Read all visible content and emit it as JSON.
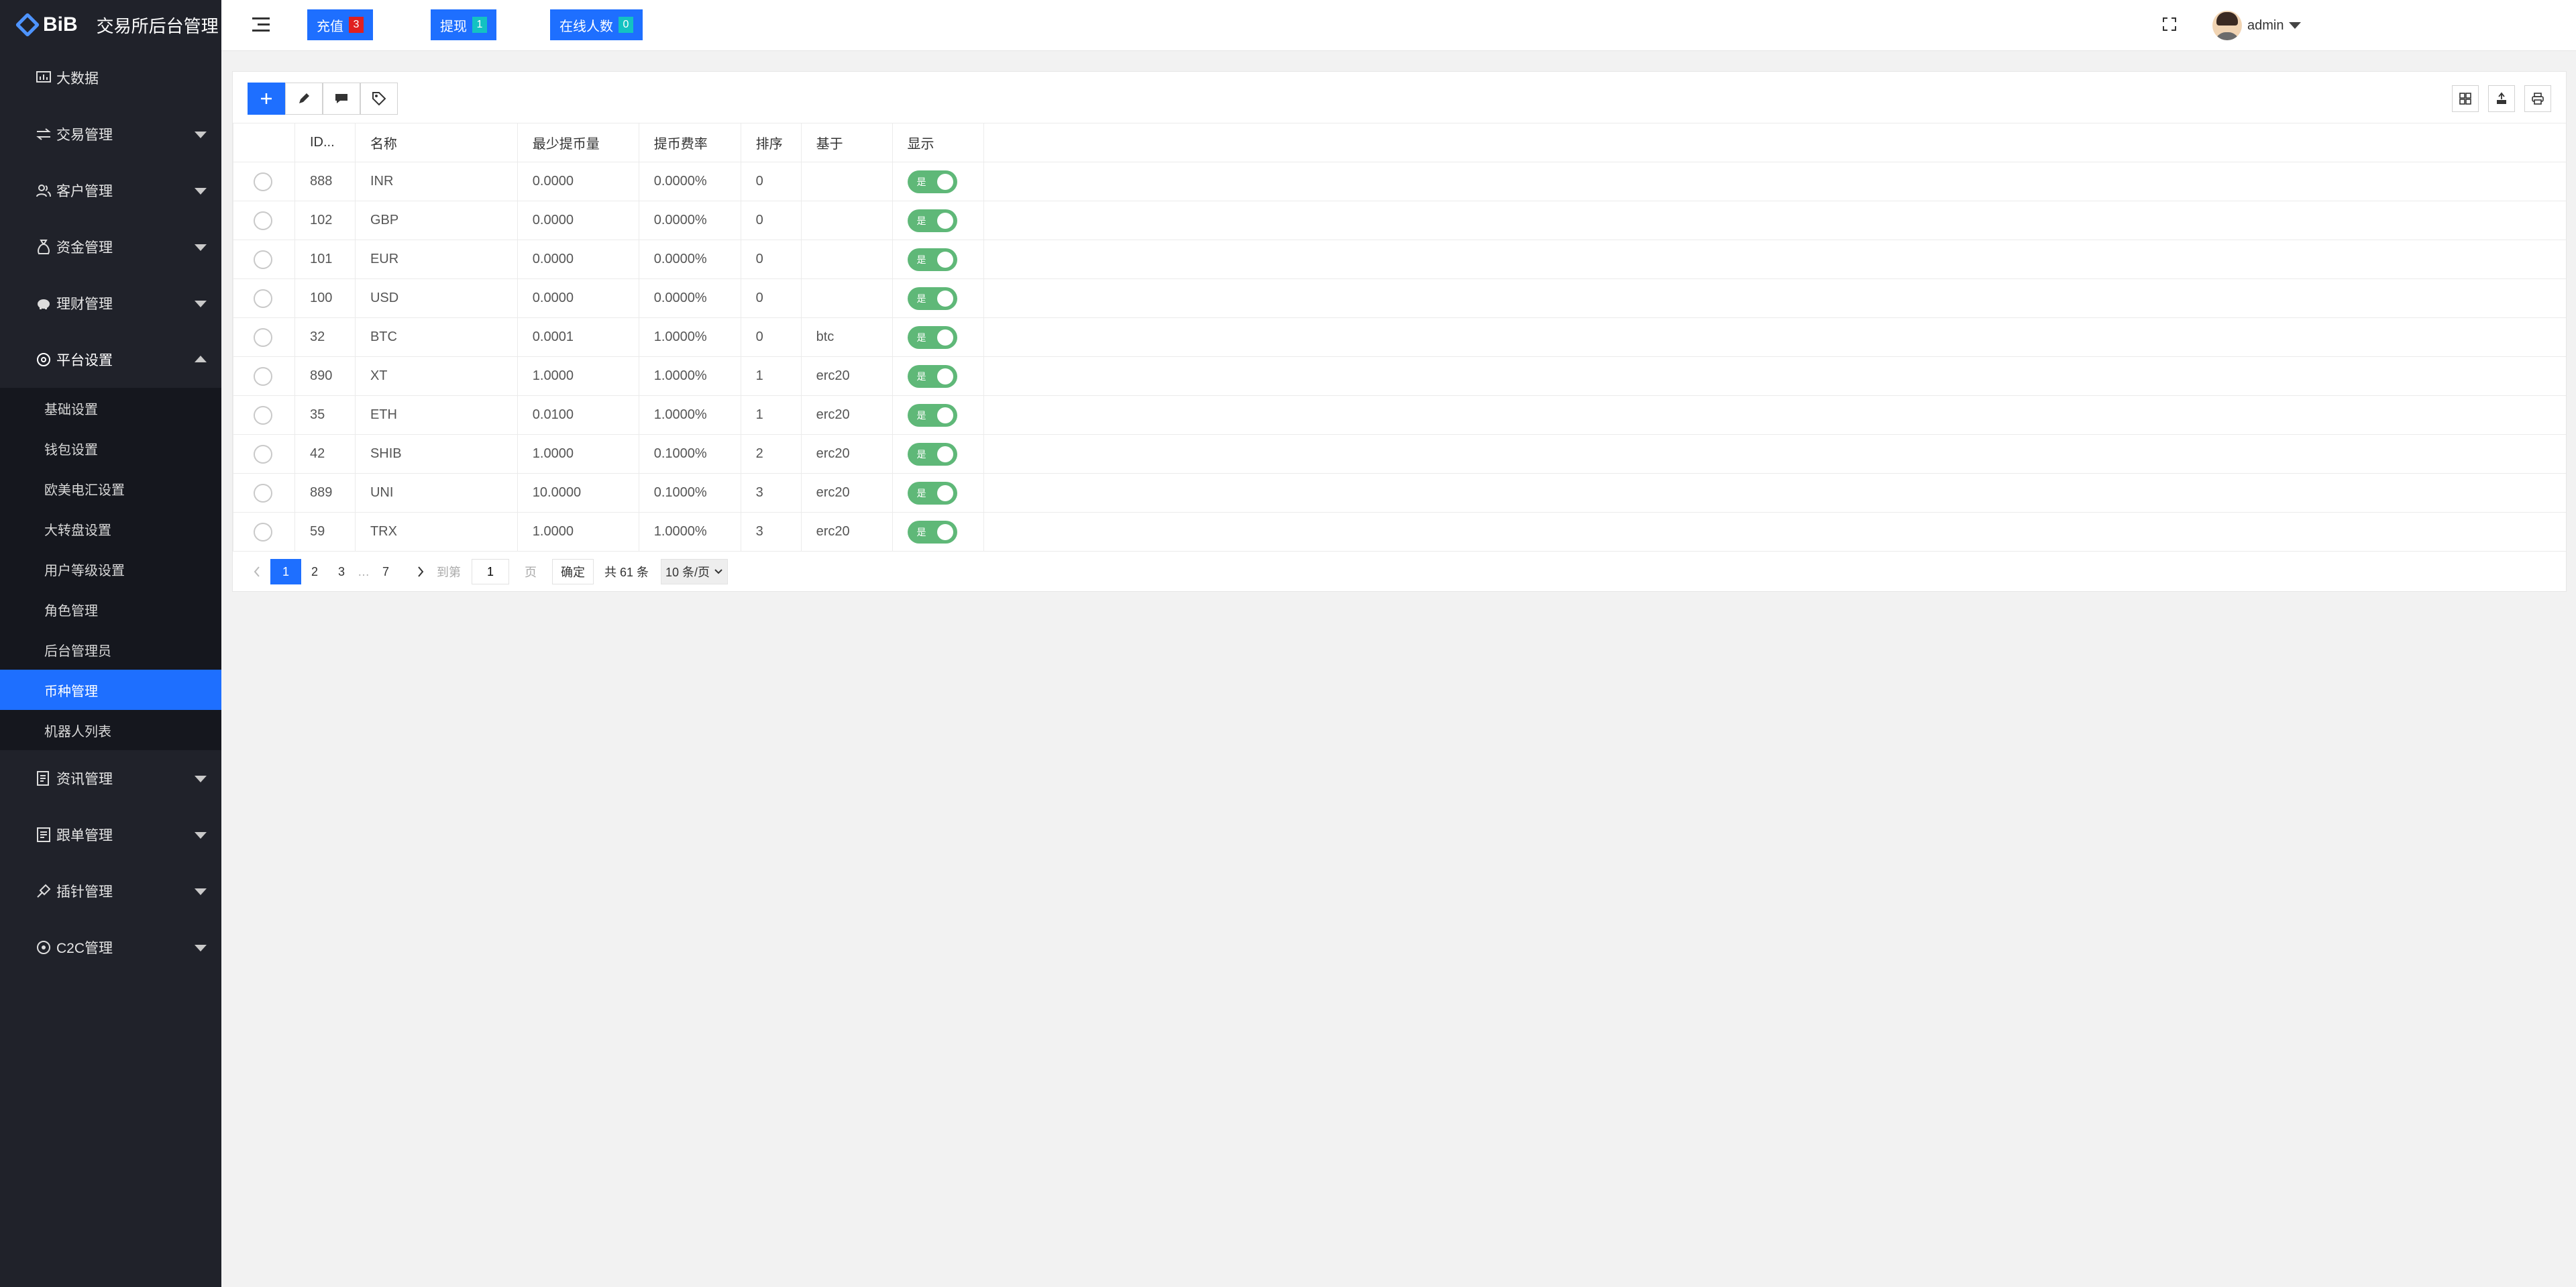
{
  "brand": {
    "logo_text": "BiB",
    "title": "交易所后台管理"
  },
  "sidebar": {
    "items": [
      {
        "label": "大数据",
        "icon": "dashboard-icon"
      },
      {
        "label": "交易管理",
        "icon": "exchange-icon"
      },
      {
        "label": "客户管理",
        "icon": "users-icon"
      },
      {
        "label": "资金管理",
        "icon": "money-bag-icon"
      },
      {
        "label": "理财管理",
        "icon": "piggy-bank-icon"
      },
      {
        "label": "平台设置",
        "icon": "settings-icon"
      },
      {
        "label": "资讯管理",
        "icon": "news-icon"
      },
      {
        "label": "跟单管理",
        "icon": "copy-trade-icon"
      },
      {
        "label": "插针管理",
        "icon": "pin-icon"
      },
      {
        "label": "C2C管理",
        "icon": "c2c-icon"
      }
    ],
    "submenu": [
      {
        "label": "基础设置"
      },
      {
        "label": "钱包设置"
      },
      {
        "label": "欧美电汇设置"
      },
      {
        "label": "大转盘设置"
      },
      {
        "label": "用户等级设置"
      },
      {
        "label": "角色管理"
      },
      {
        "label": "后台管理员"
      },
      {
        "label": "币种管理"
      },
      {
        "label": "机器人列表"
      }
    ]
  },
  "header": {
    "recharge": {
      "label": "充值",
      "count": "3",
      "badge_color": "#e02020"
    },
    "withdraw": {
      "label": "提现",
      "count": "1",
      "badge_color": "#13c2c2"
    },
    "online": {
      "label": "在线人数",
      "count": "0",
      "badge_color": "#13c2c2"
    },
    "user": "admin"
  },
  "table": {
    "columns": [
      "ID...",
      "名称",
      "最少提币量",
      "提币费率",
      "排序",
      "基于",
      "显示"
    ],
    "rows": [
      {
        "id": "888",
        "name": "INR",
        "min": "0.0000",
        "fee": "0.0000%",
        "sort": "0",
        "base": "",
        "show": "是"
      },
      {
        "id": "102",
        "name": "GBP",
        "min": "0.0000",
        "fee": "0.0000%",
        "sort": "0",
        "base": "",
        "show": "是"
      },
      {
        "id": "101",
        "name": "EUR",
        "min": "0.0000",
        "fee": "0.0000%",
        "sort": "0",
        "base": "",
        "show": "是"
      },
      {
        "id": "100",
        "name": "USD",
        "min": "0.0000",
        "fee": "0.0000%",
        "sort": "0",
        "base": "",
        "show": "是"
      },
      {
        "id": "32",
        "name": "BTC",
        "min": "0.0001",
        "fee": "1.0000%",
        "sort": "0",
        "base": "btc",
        "show": "是"
      },
      {
        "id": "890",
        "name": "XT",
        "min": "1.0000",
        "fee": "1.0000%",
        "sort": "1",
        "base": "erc20",
        "show": "是"
      },
      {
        "id": "35",
        "name": "ETH",
        "min": "0.0100",
        "fee": "1.0000%",
        "sort": "1",
        "base": "erc20",
        "show": "是"
      },
      {
        "id": "42",
        "name": "SHIB",
        "min": "1.0000",
        "fee": "0.1000%",
        "sort": "2",
        "base": "erc20",
        "show": "是"
      },
      {
        "id": "889",
        "name": "UNI",
        "min": "10.0000",
        "fee": "0.1000%",
        "sort": "3",
        "base": "erc20",
        "show": "是"
      },
      {
        "id": "59",
        "name": "TRX",
        "min": "1.0000",
        "fee": "1.0000%",
        "sort": "3",
        "base": "erc20",
        "show": "是"
      }
    ]
  },
  "pagination": {
    "pages": [
      "1",
      "2",
      "3",
      "…",
      "7"
    ],
    "goto_label": "到第",
    "goto_value": "1",
    "page_unit": "页",
    "confirm": "确定",
    "total": "共 61 条",
    "page_size": "10 条/页"
  },
  "colors": {
    "accent": "#1e6fff",
    "sidebar_bg": "#20222a",
    "switch_on": "#5fb878"
  }
}
